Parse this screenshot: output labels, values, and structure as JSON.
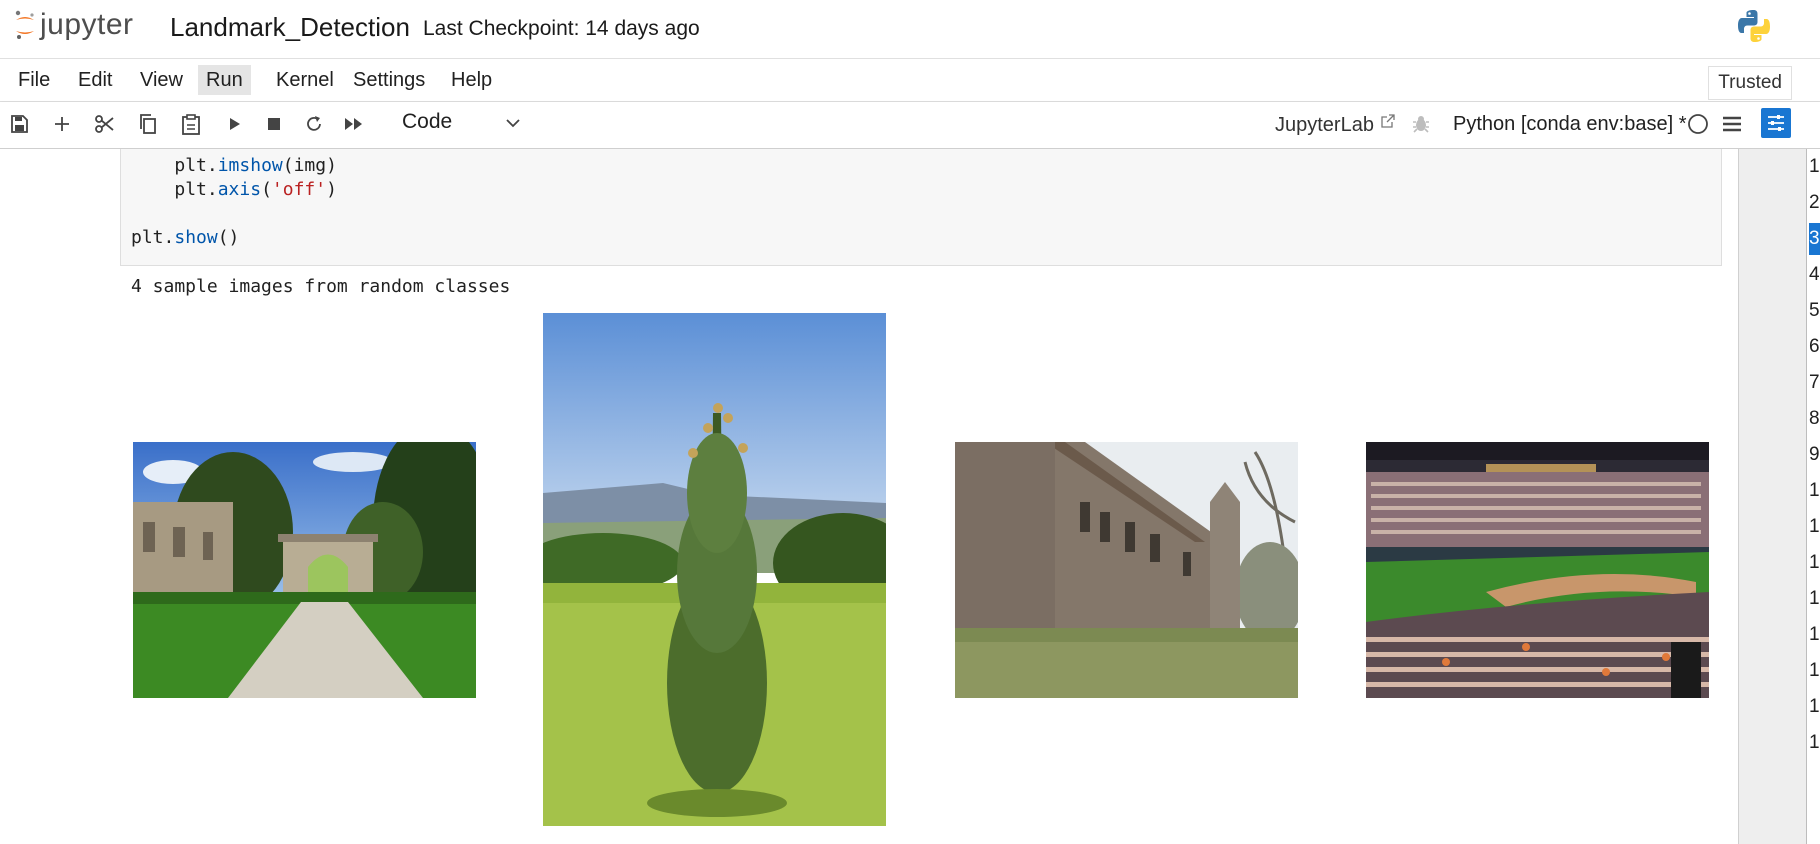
{
  "app": {
    "logo_text": "jupyter",
    "notebook_title": "Landmark_Detection",
    "checkpoint": "Last Checkpoint: 14 days ago"
  },
  "menu": [
    "File",
    "Edit",
    "View",
    "Run",
    "Kernel",
    "Settings",
    "Help"
  ],
  "trusted": "Trusted",
  "toolbar": {
    "icons": [
      "save-icon",
      "add-cell-icon",
      "cut-icon",
      "copy-icon",
      "paste-icon",
      "run-icon",
      "stop-icon",
      "restart-icon",
      "run-all-icon"
    ],
    "cell_type": "Code",
    "jupyterlab_link": "JupyterLab",
    "kernel": "Python [conda env:base] *"
  },
  "cell": {
    "code_lines": [
      {
        "indent": "    ",
        "obj": "plt",
        "attr": "imshow",
        "args": "(img)"
      },
      {
        "indent": "    ",
        "obj": "plt",
        "attr": "axis",
        "open": "(",
        "str": "'off'",
        "close": ")"
      },
      {
        "indent": "",
        "obj": "plt",
        "attr": "show",
        "args": "()"
      }
    ],
    "output_text": "4 sample images from random classes"
  },
  "sample_images": [
    {
      "name": "garden-ruins-arch",
      "shape": "landscape"
    },
    {
      "name": "thistle-on-hillside",
      "shape": "portrait"
    },
    {
      "name": "stone-church",
      "shape": "landscape"
    },
    {
      "name": "baseball-stadium",
      "shape": "landscape"
    }
  ],
  "right_line_numbers": [
    "1",
    "2",
    "3",
    "4",
    "5",
    "6",
    "7",
    "8",
    "9",
    "1",
    "1",
    "1",
    "1",
    "1",
    "1",
    "1",
    "1"
  ],
  "active_line_index": 2,
  "colors": {
    "accent": "#1976d2",
    "jupyter_orange": "#f37726"
  }
}
